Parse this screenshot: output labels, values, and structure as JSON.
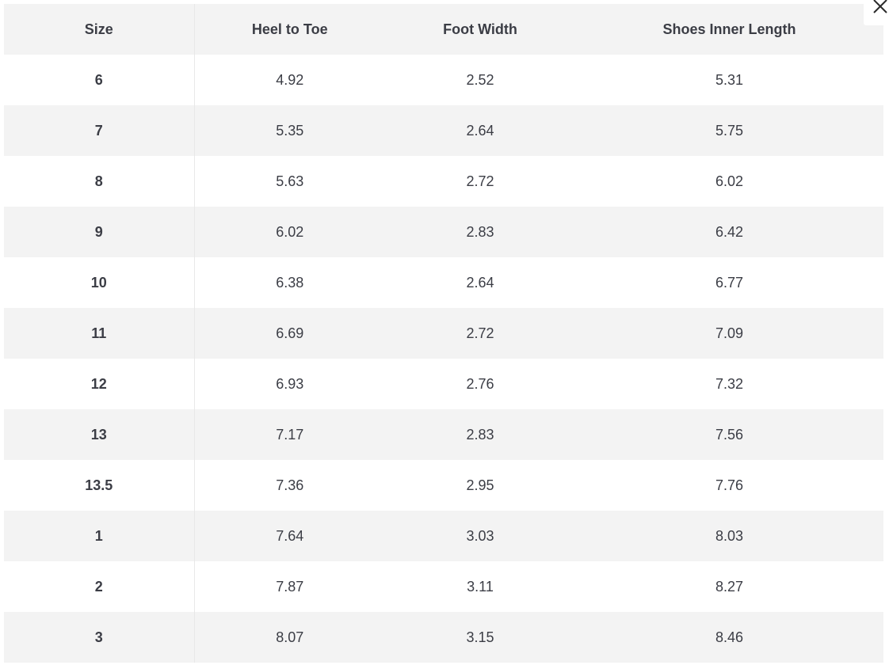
{
  "size_chart": {
    "headers": {
      "size": "Size",
      "heel_to_toe": "Heel to Toe",
      "foot_width": "Foot Width",
      "inner_length": "Shoes Inner Length"
    },
    "rows": [
      {
        "size": "6",
        "heel_to_toe": "4.92",
        "foot_width": "2.52",
        "inner_length": "5.31"
      },
      {
        "size": "7",
        "heel_to_toe": "5.35",
        "foot_width": "2.64",
        "inner_length": "5.75"
      },
      {
        "size": "8",
        "heel_to_toe": "5.63",
        "foot_width": "2.72",
        "inner_length": "6.02"
      },
      {
        "size": "9",
        "heel_to_toe": "6.02",
        "foot_width": "2.83",
        "inner_length": "6.42"
      },
      {
        "size": "10",
        "heel_to_toe": "6.38",
        "foot_width": "2.64",
        "inner_length": "6.77"
      },
      {
        "size": "11",
        "heel_to_toe": "6.69",
        "foot_width": "2.72",
        "inner_length": "7.09"
      },
      {
        "size": "12",
        "heel_to_toe": "6.93",
        "foot_width": "2.76",
        "inner_length": "7.32"
      },
      {
        "size": "13",
        "heel_to_toe": "7.17",
        "foot_width": "2.83",
        "inner_length": "7.56"
      },
      {
        "size": "13.5",
        "heel_to_toe": "7.36",
        "foot_width": "2.95",
        "inner_length": "7.76"
      },
      {
        "size": "1",
        "heel_to_toe": "7.64",
        "foot_width": "3.03",
        "inner_length": "8.03"
      },
      {
        "size": "2",
        "heel_to_toe": "7.87",
        "foot_width": "3.11",
        "inner_length": "8.27"
      },
      {
        "size": "3",
        "heel_to_toe": "8.07",
        "foot_width": "3.15",
        "inner_length": "8.46"
      }
    ]
  },
  "close_button": {
    "icon": "close-icon"
  },
  "colors": {
    "text": "#3b3d45",
    "stripe": "#f3f3f3",
    "background": "#ffffff"
  }
}
